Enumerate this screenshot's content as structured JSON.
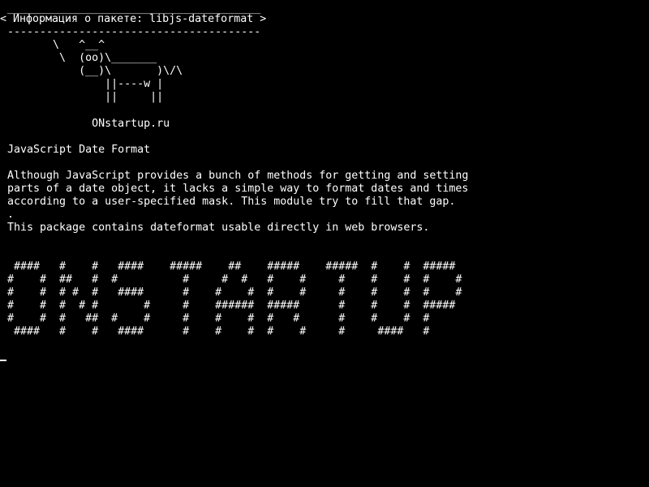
{
  "terminal": {
    "cowsay": {
      "top_border": " _______________________________________",
      "bubble_text": "< Информация о пакете: libjs-dateformat >",
      "bottom_border": " ---------------------------------------",
      "cow": [
        "        \\   ^__^",
        "         \\  (oo)\\_______",
        "            (__)\\       )\\/\\",
        "                ||----w |",
        "                ||     ||"
      ]
    },
    "site": "              ONstartup.ru",
    "package_title": " JavaScript Date Format",
    "description": [
      " Although JavaScript provides a bunch of methods for getting and setting",
      " parts of a date object, it lacks a simple way to format dates and times",
      " according to a user-specified mask. This module try to fill that gap.",
      " .",
      " This package contains dateformat usable directly in web browsers."
    ],
    "banner": [
      "  ####   #    #   ####    #####    ##    #####    #####  #    #  #####",
      " #    #  ##   #  #          #     #  #   #    #     #    #    #  #    #",
      " #    #  # #  #   ####      #    #    #  #    #     #    #    #  #    #",
      " #    #  #  # #       #     #    ######  #####      #    #    #  #####",
      " #    #  #   ##  #    #     #    #    #  #   #      #    #    #  #",
      "  ####   #    #   ####      #    #    #  #    #     #     ####   #"
    ]
  }
}
